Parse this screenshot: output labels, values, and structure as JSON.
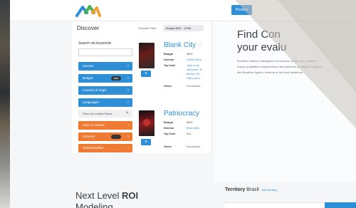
{
  "nav": {
    "product_label": "Product"
  },
  "discover": {
    "title": "Discover",
    "selected_filter_label": "Selected Filter:",
    "selected_filter_chip": "Budget $0M - 100M",
    "search_label": "Search via keywords",
    "categories": [
      "Genres",
      "Budget",
      "Country of origin",
      "Languages"
    ],
    "budget_badge": "$$$$",
    "filters_label": "Filters for United States",
    "us_filters": [
      "Year of release",
      "Screens",
      "Total Boxoffice"
    ],
    "screens_badge": "...."
  },
  "movies": [
    {
      "title": "Blank City",
      "budget": "$80K",
      "director": "Celine Danh",
      "cast": [
        "John Lurie,",
        "Jarmusch, B",
        "Michel, Ric",
        "Harry, Amo"
      ],
      "genre": "Documenta"
    },
    {
      "title": "Patriocracy",
      "budget": "$80K",
      "director": "Brian Malo",
      "cast": [
        "N/A"
      ],
      "genre": "Documenta"
    }
  ],
  "row_labels": {
    "budget": "Budget",
    "director": "Director",
    "top_cast": "Top Cast",
    "genre": "Genre"
  },
  "hero": {
    "title_line1": "Find Con",
    "title_line2": "your evalu",
    "body": "Boxoffice Metrics redesigned the research works. We created a unique qualitative characteristics like keywords quantitative aspects like Boxoffice figures, screens or the local distributor."
  },
  "bottom": {
    "next_level_pre": "Next Level ",
    "next_level_bold": "ROI",
    "next_level_line2": "Modeling",
    "territory_label": "Territory",
    "territory_value": "Brazil",
    "territory_edit": "Edit territory"
  },
  "colors": {
    "accent_blue": "#2f8fd6",
    "accent_orange": "#ef7a34",
    "logo_green": "#4caf50",
    "logo_blue": "#2f8fd6",
    "logo_orange": "#f2a03a"
  }
}
